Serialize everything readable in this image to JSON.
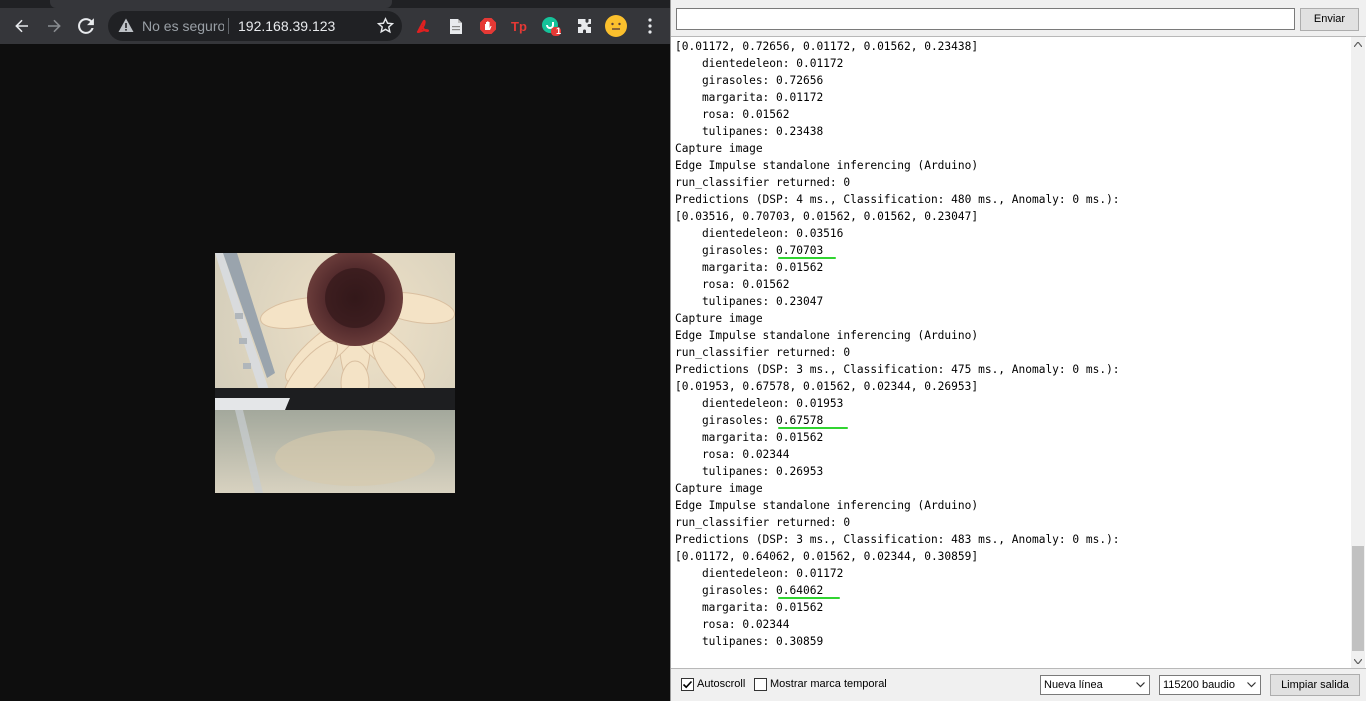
{
  "browser": {
    "security_text": "No es seguro",
    "url": "192.168.39.123",
    "extensions": [
      "pdf-icon",
      "document-icon",
      "block-hand-icon",
      "tp-icon",
      "grammar-icon",
      "puzzle-icon",
      "profile-face-icon"
    ],
    "extension_badge": "1",
    "tp_label": "Tp"
  },
  "monitor": {
    "send_input_value": "",
    "send_label": "Enviar",
    "log": [
      "[0.01172, 0.72656, 0.01172, 0.01562, 0.23438]",
      "    dientedeleon: 0.01172",
      "    girasoles: 0.72656",
      "    margarita: 0.01172",
      "    rosa: 0.01562",
      "    tulipanes: 0.23438",
      "Capture image",
      "Edge Impulse standalone inferencing (Arduino)",
      "run_classifier returned: 0",
      "Predictions (DSP: 4 ms., Classification: 480 ms., Anomaly: 0 ms.):",
      "[0.03516, 0.70703, 0.01562, 0.01562, 0.23047]",
      "    dientedeleon: 0.03516",
      "    girasoles: 0.70703",
      "    margarita: 0.01562",
      "    rosa: 0.01562",
      "    tulipanes: 0.23047",
      "Capture image",
      "Edge Impulse standalone inferencing (Arduino)",
      "run_classifier returned: 0",
      "Predictions (DSP: 3 ms., Classification: 475 ms., Anomaly: 0 ms.):",
      "[0.01953, 0.67578, 0.01562, 0.02344, 0.26953]",
      "    dientedeleon: 0.01953",
      "    girasoles: 0.67578",
      "    margarita: 0.01562",
      "    rosa: 0.02344",
      "    tulipanes: 0.26953",
      "Capture image",
      "Edge Impulse standalone inferencing (Arduino)",
      "run_classifier returned: 0",
      "Predictions (DSP: 3 ms., Classification: 483 ms., Anomaly: 0 ms.):",
      "[0.01172, 0.64062, 0.01562, 0.02344, 0.30859]",
      "    dientedeleon: 0.01172",
      "    girasoles: 0.64062",
      "    margarita: 0.01562",
      "    rosa: 0.02344",
      "    tulipanes: 0.30859"
    ],
    "autoscroll_label": "Autoscroll",
    "autoscroll_checked": true,
    "timestamp_label": "Mostrar marca temporal",
    "timestamp_checked": false,
    "line_ending": "Nueva línea",
    "baud_rate": "115200 baudio",
    "clear_label": "Limpiar salida",
    "highlight_color": "#31d431"
  }
}
